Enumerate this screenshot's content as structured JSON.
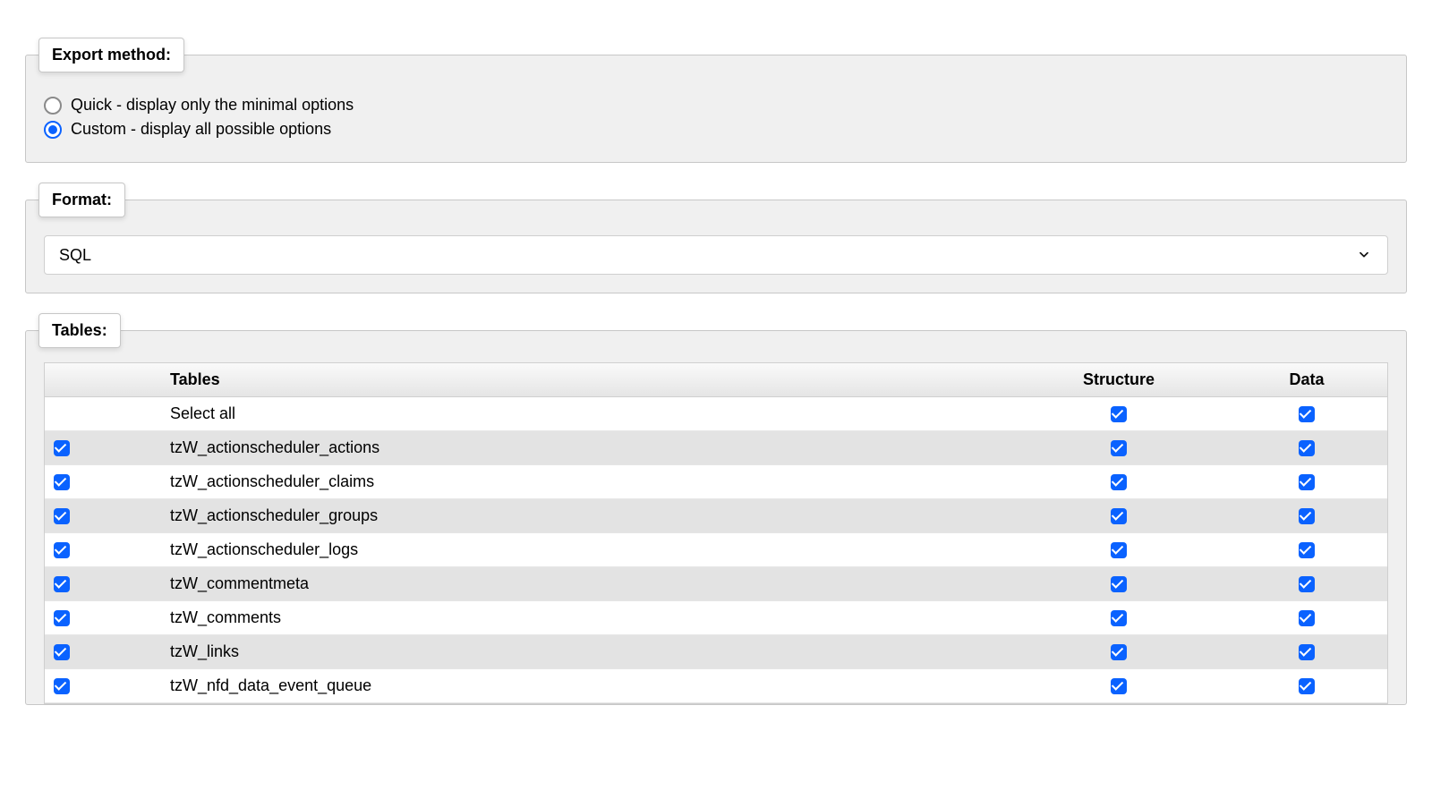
{
  "export_method": {
    "legend": "Export method:",
    "options": {
      "quick": "Quick - display only the minimal options",
      "custom": "Custom - display all possible options"
    },
    "selected": "custom"
  },
  "format": {
    "legend": "Format:",
    "selected": "SQL"
  },
  "tables": {
    "legend": "Tables:",
    "headers": {
      "tables": "Tables",
      "structure": "Structure",
      "data": "Data"
    },
    "select_all_label": "Select all",
    "select_all": {
      "structure": true,
      "data": true
    },
    "rows": [
      {
        "selected": true,
        "name": "tzW_actionscheduler_actions",
        "structure": true,
        "data": true
      },
      {
        "selected": true,
        "name": "tzW_actionscheduler_claims",
        "structure": true,
        "data": true
      },
      {
        "selected": true,
        "name": "tzW_actionscheduler_groups",
        "structure": true,
        "data": true
      },
      {
        "selected": true,
        "name": "tzW_actionscheduler_logs",
        "structure": true,
        "data": true
      },
      {
        "selected": true,
        "name": "tzW_commentmeta",
        "structure": true,
        "data": true
      },
      {
        "selected": true,
        "name": "tzW_comments",
        "structure": true,
        "data": true
      },
      {
        "selected": true,
        "name": "tzW_links",
        "structure": true,
        "data": true
      },
      {
        "selected": true,
        "name": "tzW_nfd_data_event_queue",
        "structure": true,
        "data": true
      }
    ]
  }
}
